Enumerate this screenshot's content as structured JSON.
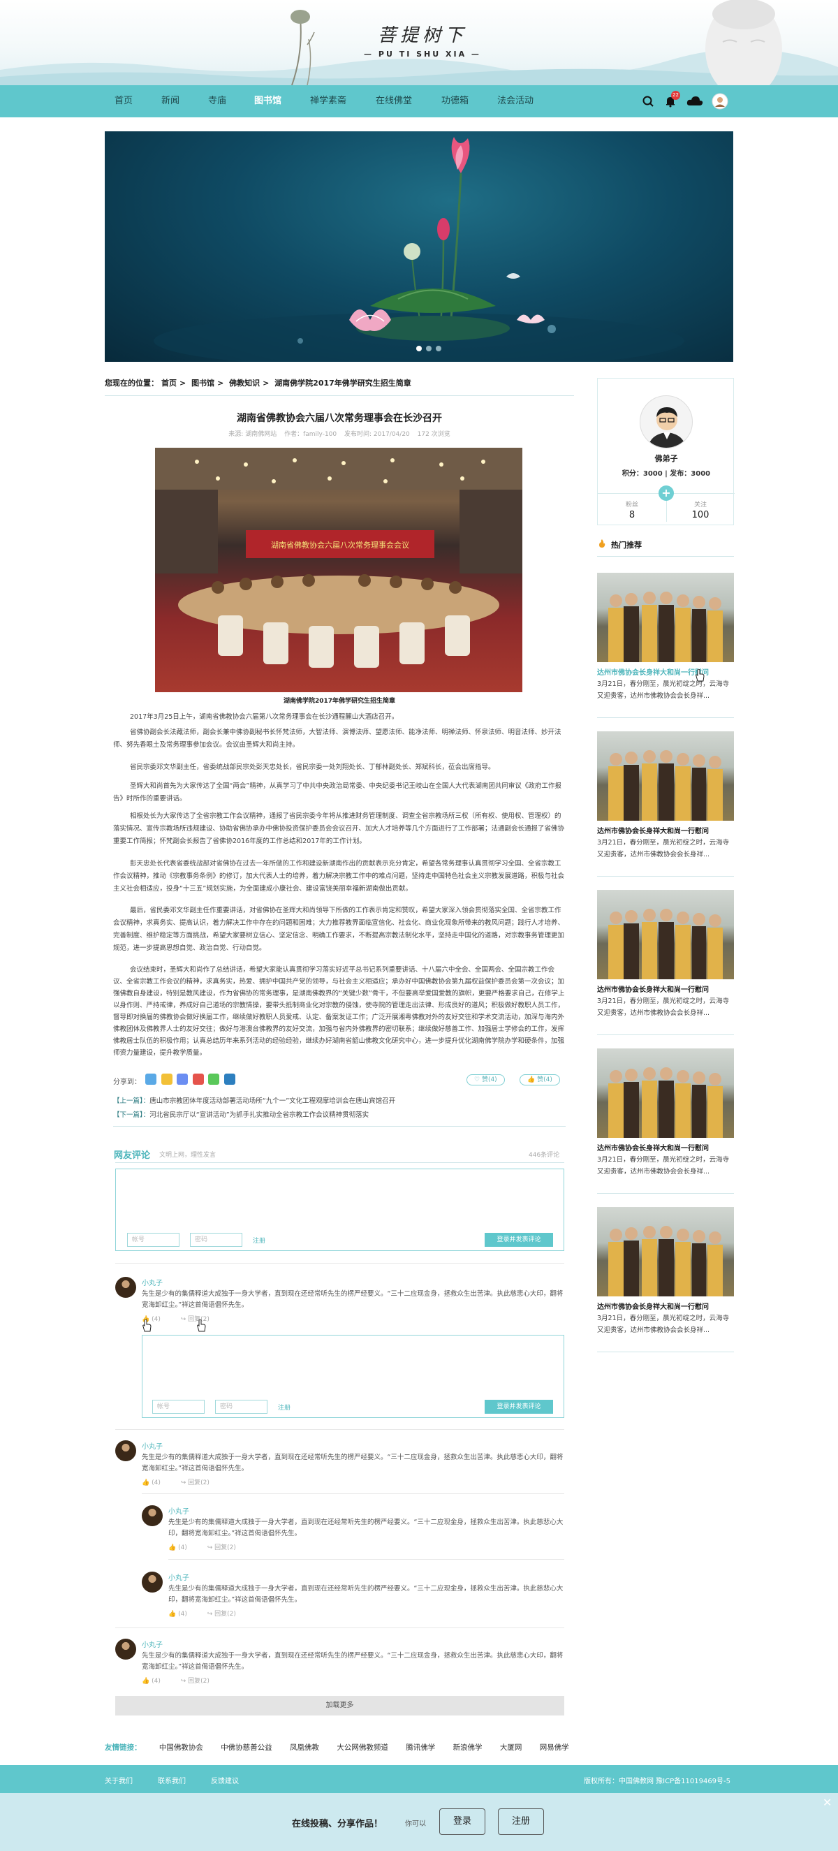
{
  "brand": {
    "name_cn": "菩提树下",
    "name_en": "— PU TI SHU XIA —"
  },
  "nav": {
    "items": [
      "首页",
      "新闻",
      "寺庙",
      "图书馆",
      "禅学素斋",
      "在线佛堂",
      "功德箱",
      "法会活动"
    ],
    "active": "图书馆",
    "notification_count": "22"
  },
  "breadcrumb": {
    "label": "您现在的位置：",
    "items": [
      "首页",
      "图书馆",
      "佛教知识",
      "湖南佛学院2017年佛学研究生招生简章"
    ]
  },
  "article": {
    "title": "湖南省佛教协会六届八次常务理事会在长沙召开",
    "meta": [
      "来源: 湖南佛网站",
      "作者：family-100",
      "发布时间: 2017/04/20",
      "172 次浏览"
    ],
    "banner_text": "湖南省佛教协会六届八次常务理事会会议",
    "caption": "湖南佛学院2017年佛学研究生招生简章",
    "paragraphs": [
      "2017年3月25日上午，湖南省佛教协会六届第八次常务理事会在长沙通程麓山大酒店召开。",
      "省佛协副会长法藏法师，副会长兼中佛协副秘书长怀梵法师，大智法师、演博法师、望愿法师、能净法师、明禅法师、怀泉法师、明音法师、妙开法师、努先香眼土及常务理事参加会议。会议由圣辉大和尚主持。",
      "省民宗委邓文华副主任，省委统战部民宗处彭天忠处长，省民宗委一处刘翔处长、丁郁林副处长、郑斌科长，莅会出席指导。",
      "圣辉大和尚首先为大家传达了全国“两会”精神，从真学习了中共中央政治局常委、中央纪委书记王岐山在全国人大代表湖南团共同审议《政府工作报告》时所作的重要讲话。",
      "相根处长为大家传达了全省宗教工作会议精神，通报了省民宗委今年将从推进财务管理制度、调查全省宗教场所三权（所有权、使用权、管理权）的落实情况、宣传宗教场所违规建设、协助省佛协承办中佛协投资保护委员会会议召开、加大人才培养等几个方面进行了工作部署；法通副会长通报了省佛协重要工作简报；怀梵副会长报告了省佛协2016年度的工作总结和2017年的工作计划。",
      "彭天忠处长代表省委统战部对省佛协在过去一年所做的工作和建设新湖南作出的贡献表示充分肯定，希望各常务理事认真贯彻学习全国、全省宗教工作会议精神，推动《宗教事务条例》的修订，加大代表人士的培养，着力解决宗教工作中的难点问题，坚持走中国特色社会主义宗教发展道路，积极与社会主义社会相适应，投身“十三五”规划实施，为全面建成小康社会、建设富饶美丽幸福新湖南做出贡献。",
      "最后，省民委邓文华副主任作重要讲话，对省佛协在圣辉大和尚领导下所做的工作表示肯定和赞叹，希望大家深入领会贯彻落实全国、全省宗教工作会议精神，求真务实、提高认识，着力解决工作中存在的问题和困难；大力推荐教界面临宣信化、社会化、商业化现象所带来的教风问题；践行人才培养、完善制度、维护稳定等方面挑战，希望大家要树立信心、坚定信念、明确工作要求，不断提高宗教法制化水平，坚持走中国化的道路，对宗教事务管理更加规范，进一步提高思想自觉、政治自觉、行动自觉。",
      "会议结束时，圣辉大和尚作了总结讲话，希望大家能认真贯彻学习落实好近平总书记系列重要讲话、十八届六中全会、全国两会、全国宗教工作会议、全省宗教工作会议的精神，求真务实，热爱、拥护中国共产党的领导，与社会主义相适应；承办好中国佛教协会第九届权益保护委员会第一次会议；加强佛教自身建设，特别是教风建设，作为省佛协的常务理事，是湖南佛教界的“关键少数”骨干，不但要高举爱国爱教的旗帜，更要严格要求自己，在修学上以身作则、严持戒律，养成好自己道场的宗教情操，要带头抵制商业化对宗教的侵蚀，使寺院的管理走出法律、形成良好的道风；积极做好教职人员工作，督导即对换届的佛教协会做好换届工作，继续做好教职人员爱戒、认定、备案发证工作；广泛开展湘粤佛教对外的友好交往和学术交流活动，加深与海内外佛教团体及佛教界人士的友好交往；做好与港澳台佛教界的友好交流，加强与省内外佛教界的密切联系；继续做好慈善工作、加强居士学修会的工作，发挥佛教居士队伍的积极作用；认真总结历年来系列活动的经验经验，继续办好湖南省韶山佛教文化研究中心，进一步提升优化湖南佛学院办学和硬条件，加强师资力量建设，提升教学质量。"
    ],
    "share_label": "分享到：",
    "likes": "赞(4)",
    "views": "赞(4)",
    "prev": {
      "label": "【上一篇】：",
      "text": "唐山市宗教团体年度活动部署活动场所“九个一”文化工程观摩培训会在唐山宾馆召开"
    },
    "next": {
      "label": "【下一篇】：",
      "text": "河北省民宗厅以“宣讲活动”为抓手扎实推动全省宗教工作会议精神贯彻落实"
    }
  },
  "comments": {
    "title": "网友评论",
    "subtitle": "文明上网，理性发言",
    "count": "446条评论",
    "account_placeholder": "帐号",
    "password_placeholder": "密码",
    "register": "注册",
    "submit": "登录并发表评论",
    "load_more": "加载更多",
    "items": [
      {
        "name": "小丸子",
        "text": "先生是少有的集儒释道大成独于一身大学者，直到现在还经常听先生的楞严经要义。“三十二应现金身，拯救众生出苦津。执此慈悲心大印，翻将宽海卸红尘。”祥这首偈语倡怀先生。",
        "like": "(4)",
        "reply": "回复(2)"
      },
      {
        "name": "小丸子",
        "text": "先生是少有的集儒释道大成独于一身大学者，直到现在还经常听先生的楞严经要义。“三十二应现金身，拯救众生出苦津。执此慈悲心大印，翻将宽海卸红尘。”祥这首偈语倡怀先生。",
        "like": "(4)",
        "reply": "回复(2)"
      },
      {
        "name": "小丸子",
        "text": "先生是少有的集儒释道大成独于一身大学者，直到现在还经常听先生的楞严经要义。“三十二应现金身，拯救众生出苦津。执此慈悲心大印，翻将宽海卸红尘。”祥这首偈语倡怀先生。",
        "like": "(4)",
        "reply": "回复(2)"
      },
      {
        "name": "小丸子",
        "text": "先生是少有的集儒释道大成独于一身大学者，直到现在还经常听先生的楞严经要义。“三十二应现金身，拯救众生出苦津。执此慈悲心大印，翻将宽海卸红尘。”祥这首偈语倡怀先生。",
        "like": "(4)",
        "reply": "回复(2)"
      },
      {
        "name": "小丸子",
        "text": "先生是少有的集儒释道大成独于一身大学者，直到现在还经常听先生的楞严经要义。“三十二应现金身，拯救众生出苦津。执此慈悲心大印，翻将宽海卸红尘。”祥这首偈语倡怀先生。",
        "like": "(4)",
        "reply": "回复(2)"
      }
    ]
  },
  "profile": {
    "name": "佛弟子",
    "stats": "积分：3000 | 发布：3000",
    "plus": "+",
    "left_label": "粉丝",
    "left_value": "8",
    "right_label": "关注",
    "right_value": "100"
  },
  "hot": {
    "title": "热门推荐",
    "items": [
      {
        "title": "达州市佛协会长身祥大和尚一行慰问",
        "desc": "3月21日，春分刚至，晨光初绽之时，云海寺又迎贵客，达州市佛教协会会长身祥..."
      },
      {
        "title": "达州市佛协会长身祥大和尚一行慰问",
        "desc": "3月21日，春分刚至，晨光初绽之时，云海寺又迎贵客，达州市佛教协会会长身祥..."
      },
      {
        "title": "达州市佛协会长身祥大和尚一行慰问",
        "desc": "3月21日，春分刚至，晨光初绽之时，云海寺又迎贵客，达州市佛教协会会长身祥..."
      },
      {
        "title": "达州市佛协会长身祥大和尚一行慰问",
        "desc": "3月21日，春分刚至，晨光初绽之时，云海寺又迎贵客，达州市佛教协会会长身祥..."
      },
      {
        "title": "达州市佛协会长身祥大和尚一行慰问",
        "desc": "3月21日，春分刚至，晨光初绽之时，云海寺又迎贵客，达州市佛教协会会长身祥..."
      }
    ]
  },
  "friend_links": {
    "label": "友情链接：",
    "items": [
      "中国佛教协会",
      "中佛协慈善公益",
      "凤凰佛教",
      "大公网佛教频道",
      "腾讯佛学",
      "新浪佛学",
      "大厦网",
      "网易佛学"
    ]
  },
  "footer": {
    "links": [
      "关于我们",
      "联系我们",
      "反馈建议"
    ],
    "copyright": "版权所有：中国佛教网 豫ICP备11019469号-5"
  },
  "bottom_bar": {
    "slogan": "在线投稿、分享作品！",
    "question": "你可以",
    "login": "登录",
    "register": "注册",
    "close": "✕"
  },
  "colors": {
    "accent": "#5fc7cc",
    "link": "#4db5bb"
  }
}
